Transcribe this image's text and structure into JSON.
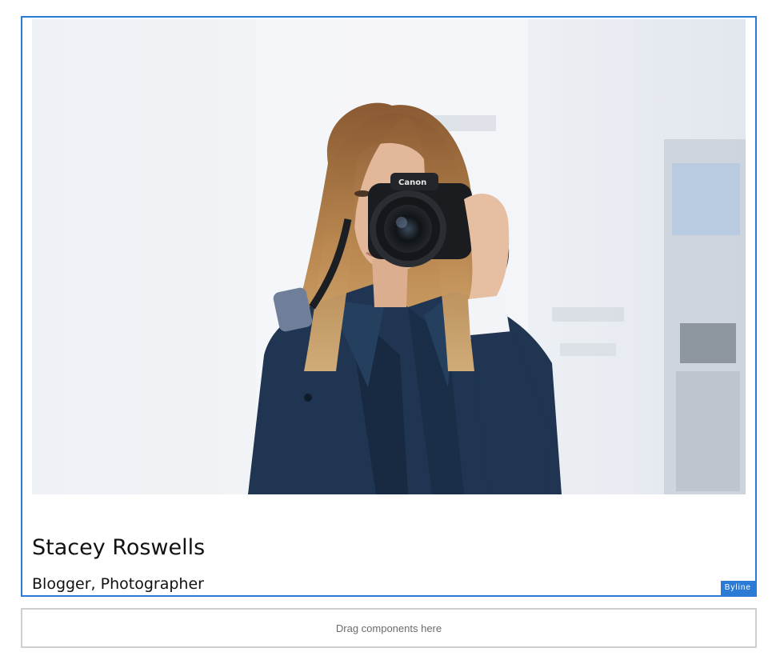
{
  "byline": {
    "name": "Stacey Roswells",
    "occupations": "Blogger, Photographer",
    "component_label": "Byline",
    "image_alt": "Woman holding a Canon camera",
    "camera_brand": "Canon"
  },
  "drop_zone": {
    "placeholder": "Drag components here"
  },
  "colors": {
    "selection_border": "#2b7bd6",
    "drop_zone_border": "#cfcfcf",
    "label_background": "#2b7bd6"
  }
}
